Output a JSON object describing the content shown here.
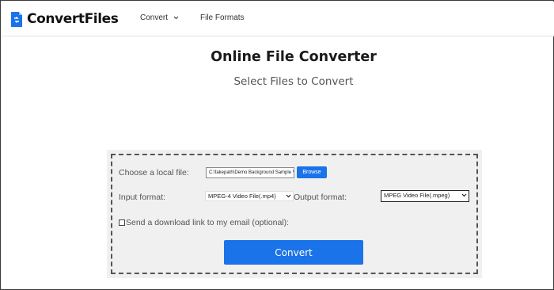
{
  "header": {
    "logo_text": "ConvertFiles",
    "nav": [
      {
        "label": "Convert"
      },
      {
        "label": "File Formats"
      }
    ]
  },
  "main": {
    "title": "Online File Converter",
    "subtitle": "Select Files to Convert"
  },
  "form": {
    "choose_label": "Choose a local file:",
    "file_value": "C:\\fakepath\\Demo Background Sample Vc",
    "browse_label": "Browse",
    "input_format_label": "Input format:",
    "input_format_value": "MPEG-4 Video File(.mp4)",
    "output_format_label": "Output format:",
    "output_format_value": "MPEG Video File(.mpeg)",
    "email_label": "Send a download link to my email (optional):",
    "convert_label": "Convert"
  },
  "colors": {
    "accent": "#1a73e8",
    "panel_bg": "#f0f0f0"
  },
  "icons": {
    "logo": "file-convert-icon",
    "nav_dropdown": "chevron-down-icon",
    "select_caret": "chevron-down-icon"
  }
}
